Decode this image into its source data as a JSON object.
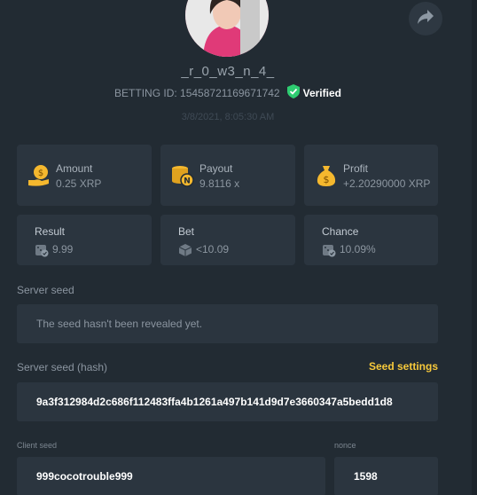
{
  "profile": {
    "username": "_r_0_w3_n_4_",
    "betting_id": "BETTING ID: 15458721169671742",
    "verified_label": "Verified",
    "timestamp": "3/8/2021, 8:05:30 AM"
  },
  "stats": {
    "amount": {
      "label": "Amount",
      "value": "0.25 XRP",
      "icon": "coin-hand-icon"
    },
    "payout": {
      "label": "Payout",
      "value": "9.8116 x",
      "icon": "coin-stack-icon"
    },
    "profit": {
      "label": "Profit",
      "value": "+2.20290000 XRP",
      "icon": "money-bag-icon"
    }
  },
  "details": {
    "result": {
      "label": "Result",
      "value": "9.99",
      "icon": "dice-check-icon"
    },
    "bet": {
      "label": "Bet",
      "value": "<10.09",
      "icon": "cube-icon"
    },
    "chance": {
      "label": "Chance",
      "value": "10.09%",
      "icon": "dice-check-icon"
    }
  },
  "server_seed": {
    "label": "Server seed",
    "value": "The seed hasn't been revealed yet."
  },
  "server_seed_hash": {
    "label": "Server seed (hash)",
    "settings_link": "Seed settings",
    "value": "9a3f312984d2c686f112483ffa4b1261a497b141d9d7e3660347a5bedd1d8"
  },
  "client_seed": {
    "label": "Client seed",
    "value": "999cocotrouble999"
  },
  "nonce": {
    "label": "nonce",
    "value": "1598"
  },
  "colors": {
    "background": "#222b33",
    "card": "#2b353f",
    "accent_yellow": "#f7c93b",
    "verified_green": "#2ecc71"
  }
}
